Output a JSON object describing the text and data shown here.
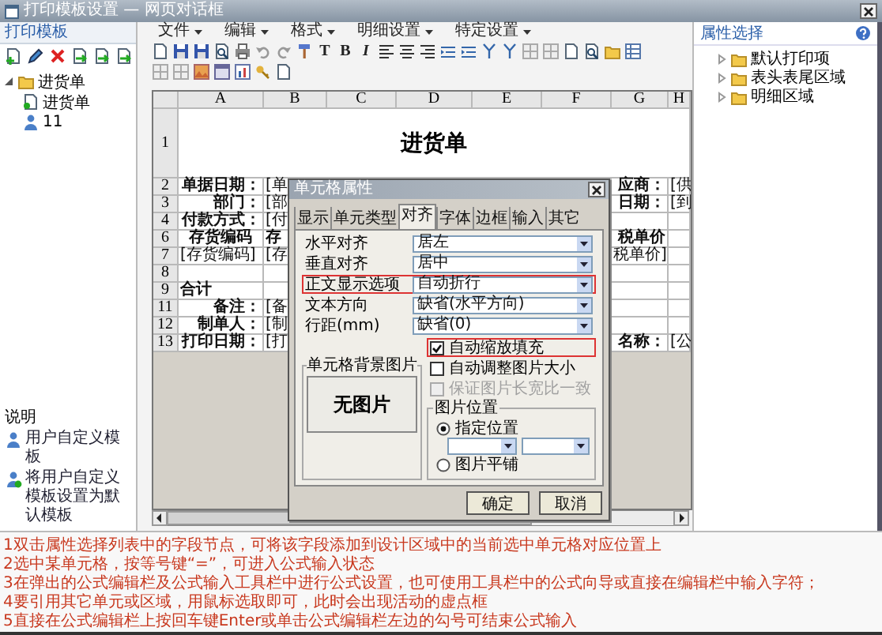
{
  "window": {
    "title": "打印模板设置 — 网页对话框"
  },
  "template_panel": {
    "title": "打印模板",
    "tree": [
      {
        "label": "进货单",
        "expanded": true,
        "children": [
          {
            "label": "进货单",
            "kind": "system"
          },
          {
            "label": "11",
            "kind": "user"
          }
        ]
      }
    ],
    "legend_title": "说明",
    "legend": [
      {
        "label": "用户自定义模板",
        "kind": "user"
      },
      {
        "label": "将用户自定义模板设置为默认模板",
        "kind": "default"
      }
    ]
  },
  "menu": [
    "文件",
    "编辑",
    "格式",
    "明细设置",
    "特定设置"
  ],
  "toolbar": {
    "text_buttons": [
      "T",
      "B",
      "I"
    ]
  },
  "sheet": {
    "columns": [
      "A",
      "B",
      "C",
      "D",
      "E",
      "F",
      "G",
      "H"
    ],
    "rows": [
      {
        "number": "1",
        "kind": "title",
        "title": "进货单"
      },
      {
        "number": "2",
        "kind": "field",
        "label": "单据日期：",
        "value": "[单",
        "right_label": "应商：",
        "right_value": "[供"
      },
      {
        "number": "3",
        "kind": "field",
        "label": "部门：",
        "value": "[部",
        "right_label": "日期：",
        "right_value": "[到"
      },
      {
        "number": "4",
        "kind": "field",
        "label": "付款方式：",
        "value": "[付"
      },
      {
        "number": "6",
        "kind": "header",
        "label": "存货编码",
        "value": "存",
        "right_label": "税单价"
      },
      {
        "number": "7",
        "kind": "data",
        "label": "[存货编码]",
        "value": "[存",
        "right_label": "税单价]"
      },
      {
        "number": "8",
        "kind": "data"
      },
      {
        "number": "9",
        "kind": "total",
        "label": "合计"
      },
      {
        "number": "11",
        "kind": "field",
        "label": "备注：",
        "value": "[备"
      },
      {
        "number": "12",
        "kind": "field",
        "label": "制单人：",
        "value": "[制"
      },
      {
        "number": "13",
        "kind": "field",
        "label": "打印日期：",
        "value": "[打",
        "right_label": "名称：",
        "right_value": "[公"
      }
    ]
  },
  "dialog": {
    "title": "单元格属性",
    "tabs": [
      {
        "label": "显示",
        "selected": false
      },
      {
        "label": "单元类型",
        "selected": false
      },
      {
        "label": "对齐",
        "selected": true
      },
      {
        "label": "字体",
        "selected": false
      },
      {
        "label": "边框",
        "selected": false
      },
      {
        "label": "输入",
        "selected": false
      },
      {
        "label": "其它",
        "selected": false
      }
    ],
    "fields": [
      {
        "label": "水平对齐",
        "value": "居左",
        "highlighted": false
      },
      {
        "label": "垂直对齐",
        "value": "居中",
        "highlighted": false
      },
      {
        "label": "正文显示选项",
        "value": "自动折行",
        "highlighted": true
      },
      {
        "label": "文本方向",
        "value": "缺省(水平方向)",
        "highlighted": false
      },
      {
        "label": "行距(mm)",
        "value": "缺省(0)",
        "highlighted": false
      }
    ],
    "checkboxes": [
      {
        "label": "自动缩放填充",
        "checked": true,
        "disabled": false,
        "highlighted": true
      },
      {
        "label": "自动调整图片大小",
        "checked": false,
        "disabled": false,
        "highlighted": false
      },
      {
        "label": "保证图片长宽比一致",
        "checked": false,
        "disabled": true,
        "highlighted": false
      }
    ],
    "background_group": {
      "title": "单元格背景图片",
      "preview": "无图片"
    },
    "position_group": {
      "title": "图片位置",
      "options": [
        {
          "label": "指定位置",
          "selected": true
        },
        {
          "label": "图片平铺",
          "selected": false
        }
      ]
    },
    "buttons": [
      "确定",
      "取消"
    ]
  },
  "property_panel": {
    "title": "属性选择",
    "tree": [
      {
        "label": "默认打印项",
        "expanded": false
      },
      {
        "label": "表头表尾区域",
        "expanded": false
      },
      {
        "label": "明细区域",
        "expanded": false
      }
    ]
  },
  "notes": [
    "1双击属性选择列表中的字段节点，可将该字段添加到设计区域中的当前选中单元格对应位置上",
    "2选中某单元格，按等号键“=”，可进入公式输入状态",
    "3在弹出的公式编辑栏及公式输入工具栏中进行公式设置，也可使用工具栏中的公式向导或直接在编辑栏中输入字符；",
    "4要引用其它单元或区域，用鼠标选取即可，此时会出现活动的虚点框",
    "5直接在公式编辑栏上按回车键Enter或单击公式编辑栏左边的勾号可结束公式输入"
  ]
}
